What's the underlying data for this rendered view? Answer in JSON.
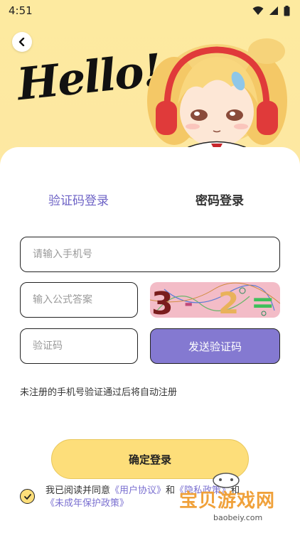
{
  "status_bar": {
    "time": "4:51"
  },
  "header": {
    "title": "Hello!"
  },
  "tabs": [
    {
      "label": "验证码登录",
      "active": true
    },
    {
      "label": "密码登录",
      "active": false
    }
  ],
  "form": {
    "phone_placeholder": "请输入手机号",
    "formula_placeholder": "输入公式答案",
    "code_placeholder": "验证码",
    "captcha": {
      "first": "3",
      "operator": "-",
      "second": "2",
      "equals": "="
    },
    "send_code_label": "发送验证码",
    "hint": "未注册的手机号验证通过后将自动注册"
  },
  "login_label": "确定登录",
  "agreement": {
    "prefix": "我已阅读并同意",
    "user_agreement": "《用户协议》",
    "and1": "和",
    "privacy_policy": "《隐私政策》",
    "and2": "和",
    "minor_policy": "《未成年保护政策》"
  },
  "watermark": {
    "text": "宝贝游戏网",
    "url": "baobeiy.com"
  },
  "colors": {
    "accent": "#8479d1",
    "tab_active": "#6e63c6",
    "background": "#fde7a2",
    "button_yellow": "#fdde7a"
  }
}
